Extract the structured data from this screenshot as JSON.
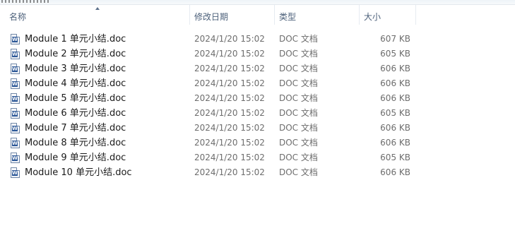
{
  "columns": {
    "name": "名称",
    "date": "修改日期",
    "type": "类型",
    "size": "大小"
  },
  "sort_indicator": "chevron-up-icon",
  "files": [
    {
      "name": "Module 1 单元小结.doc",
      "date": "2024/1/20 15:02",
      "type": "DOC 文档",
      "size": "607 KB"
    },
    {
      "name": "Module 2 单元小结.doc",
      "date": "2024/1/20 15:02",
      "type": "DOC 文档",
      "size": "605 KB"
    },
    {
      "name": "Module 3 单元小结.doc",
      "date": "2024/1/20 15:02",
      "type": "DOC 文档",
      "size": "606 KB"
    },
    {
      "name": "Module 4 单元小结.doc",
      "date": "2024/1/20 15:02",
      "type": "DOC 文档",
      "size": "606 KB"
    },
    {
      "name": "Module 5 单元小结.doc",
      "date": "2024/1/20 15:02",
      "type": "DOC 文档",
      "size": "606 KB"
    },
    {
      "name": "Module 6 单元小结.doc",
      "date": "2024/1/20 15:02",
      "type": "DOC 文档",
      "size": "605 KB"
    },
    {
      "name": "Module 7 单元小结.doc",
      "date": "2024/1/20 15:02",
      "type": "DOC 文档",
      "size": "606 KB"
    },
    {
      "name": "Module 8 单元小结.doc",
      "date": "2024/1/20 15:02",
      "type": "DOC 文档",
      "size": "606 KB"
    },
    {
      "name": "Module 9 单元小结.doc",
      "date": "2024/1/20 15:02",
      "type": "DOC 文档",
      "size": "605 KB"
    },
    {
      "name": "Module 10 单元小结.doc",
      "date": "2024/1/20 15:02",
      "type": "DOC 文档",
      "size": "606 KB"
    }
  ]
}
